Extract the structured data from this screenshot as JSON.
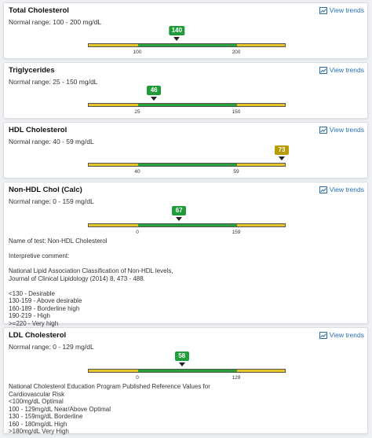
{
  "trends_label": "View trends",
  "colors": {
    "in_range": "#27a23a",
    "out_of_range": "#e6c52a",
    "link": "#2a6fb0",
    "badge_normal": "#1f9d3a",
    "badge_abnormal": "#b89b00"
  },
  "tests": [
    {
      "title": "Total Cholesterol",
      "range": "Normal range: 100 - 200 mg/dL",
      "value": "140",
      "status": "normal",
      "low_label": "100",
      "high_label": "200",
      "value_num": 140,
      "low": 100,
      "high": 200,
      "note": ""
    },
    {
      "title": "Triglycerides",
      "range": "Normal range: 25 - 150 mg/dL",
      "value": "46",
      "status": "normal",
      "low_label": "25",
      "high_label": "150",
      "value_num": 46,
      "low": 25,
      "high": 150,
      "note": ""
    },
    {
      "title": "HDL Cholesterol",
      "range": "Normal range: 40 - 59 mg/dL",
      "value": "73",
      "status": "abnormal",
      "low_label": "40",
      "high_label": "59",
      "value_num": 73,
      "low": 40,
      "high": 59,
      "note": ""
    },
    {
      "title": "Non-HDL Chol (Calc)",
      "range": "Normal range: 0 - 159 mg/dL",
      "value": "67",
      "status": "normal",
      "low_label": "0",
      "high_label": "159",
      "value_num": 67,
      "low": 0,
      "high": 159,
      "note": "Name of test: Non-HDL Cholesterol\n\nInterpretive comment:\n\nNational Lipid Association Classification of Non-HDL levels,\nJournal of Clinical Lipidology (2014) 8, 473 - 488.\n\n<130 - Desirable\n130-159 - Above desirable\n160-189 - Borderline high\n190-219 - High\n>=220 - Very high"
    },
    {
      "title": "LDL Cholesterol",
      "range": "Normal range: 0 - 129 mg/dL",
      "value": "58",
      "status": "normal",
      "low_label": "0",
      "high_label": "129",
      "value_num": 58,
      "low": 0,
      "high": 129,
      "note": "National Cholesterol Education Program Published Reference Values for\nCardiovascular Risk\n<100mg/dL Optimal\n100 - 129mg/dL Near/Above Optimal\n130 - 159mg/dL Borderline\n160 - 180mg/dL High\n>180mg/dL Very High"
    }
  ]
}
